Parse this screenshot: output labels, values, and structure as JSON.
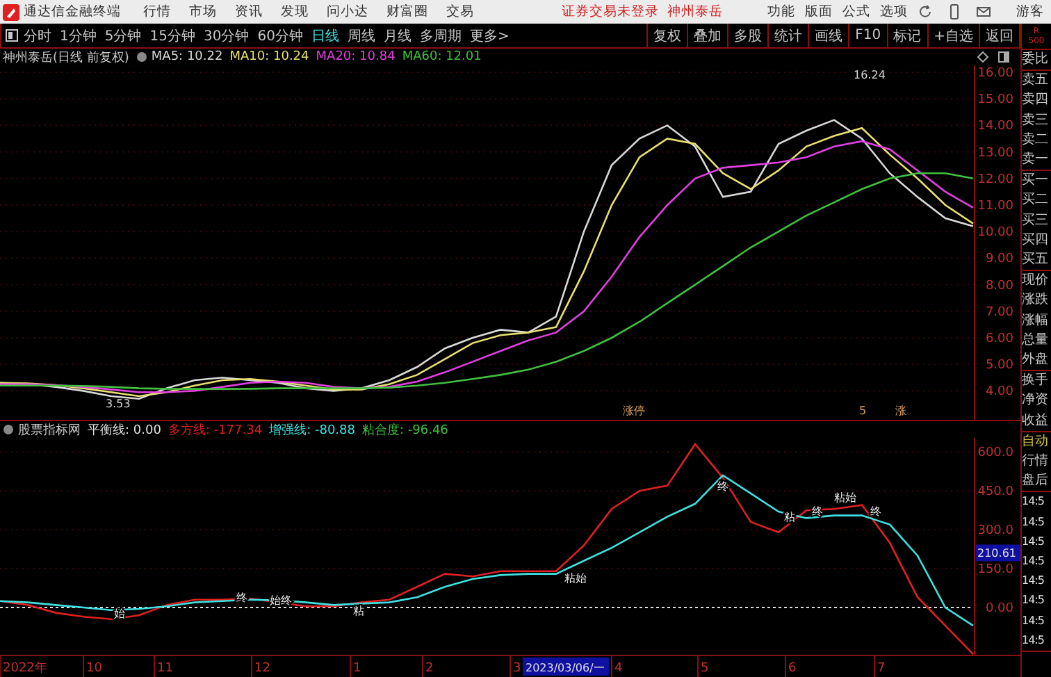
{
  "menu_bar": {
    "app_title": "通达信金融终端",
    "items": [
      "行情",
      "市场",
      "资讯",
      "发现",
      "问小达",
      "财富圈",
      "交易"
    ],
    "status": [
      "证券交易未登录",
      "神州泰岳"
    ],
    "right_items": [
      "功能",
      "版面",
      "公式",
      "选项"
    ],
    "user": "游客"
  },
  "toolbar": {
    "tabs": [
      {
        "label": "分时",
        "selected": false
      },
      {
        "label": "1分钟",
        "selected": false
      },
      {
        "label": "5分钟",
        "selected": false
      },
      {
        "label": "15分钟",
        "selected": false
      },
      {
        "label": "30分钟",
        "selected": false
      },
      {
        "label": "60分钟",
        "selected": false
      },
      {
        "label": "日线",
        "selected": true
      },
      {
        "label": "周线",
        "selected": false
      },
      {
        "label": "月线",
        "selected": false
      },
      {
        "label": "多周期",
        "selected": false
      },
      {
        "label": "更多>",
        "selected": false
      }
    ],
    "buttons": [
      "复权",
      "叠加",
      "多股",
      "统计",
      "画线",
      "F10",
      "标记",
      "+自选",
      "返回"
    ]
  },
  "upper_chart": {
    "title": "神州泰岳(日线 前复权)",
    "legend_values": [
      ": 10.22",
      ": 10.24",
      ": 10.84",
      ": 12.01"
    ],
    "markers": [
      "涨停",
      "5",
      "涨"
    ],
    "chart_data": {
      "type": "line",
      "grid": true,
      "ylim": [
        2.91,
        16.26
      ],
      "yticks": [
        {
          "value": 16,
          "label": "16.00"
        },
        {
          "value": 15,
          "label": "15.00"
        },
        {
          "value": 14,
          "label": "14.00"
        },
        {
          "value": 13,
          "label": "13.00"
        },
        {
          "value": 12,
          "label": "12.00"
        },
        {
          "value": 11,
          "label": "11.00"
        },
        {
          "value": 10,
          "label": "10.00"
        },
        {
          "value": 9,
          "label": "9.00"
        },
        {
          "value": 8,
          "label": "8.00"
        },
        {
          "value": 7,
          "label": "7.00"
        },
        {
          "value": 6,
          "label": "6.00"
        },
        {
          "value": 5,
          "label": "5.00"
        },
        {
          "value": 4,
          "label": "4.00"
        }
      ],
      "series": [
        {
          "name": "MA5",
          "color": "#d8d8d8",
          "values": [
            4.3,
            4.25,
            4.15,
            4.0,
            3.8,
            3.7,
            4.1,
            4.4,
            4.5,
            4.4,
            4.3,
            4.1,
            4.0,
            4.1,
            4.4,
            4.9,
            5.6,
            6.0,
            6.3,
            6.2,
            6.8,
            10.0,
            12.5,
            13.5,
            14.0,
            13.2,
            11.3,
            11.5,
            13.3,
            13.8,
            14.2,
            13.5,
            12.2,
            11.3,
            10.5,
            10.2
          ]
        },
        {
          "name": "MA10",
          "color": "#e8e070",
          "values": [
            4.3,
            4.28,
            4.22,
            4.1,
            3.95,
            3.8,
            3.95,
            4.2,
            4.4,
            4.45,
            4.35,
            4.2,
            4.05,
            4.05,
            4.25,
            4.6,
            5.2,
            5.8,
            6.1,
            6.2,
            6.4,
            8.5,
            11.0,
            12.8,
            13.5,
            13.3,
            12.2,
            11.6,
            12.3,
            13.2,
            13.6,
            13.9,
            12.9,
            12.0,
            11.0,
            10.3
          ]
        },
        {
          "name": "MA20",
          "color": "#e040e0",
          "values": [
            4.25,
            4.25,
            4.22,
            4.15,
            4.05,
            3.95,
            3.95,
            4.0,
            4.15,
            4.3,
            4.35,
            4.3,
            4.15,
            4.1,
            4.15,
            4.35,
            4.7,
            5.1,
            5.5,
            5.9,
            6.2,
            7.0,
            8.3,
            9.8,
            11.0,
            12.0,
            12.4,
            12.5,
            12.6,
            12.8,
            13.2,
            13.4,
            13.1,
            12.3,
            11.5,
            10.9
          ]
        },
        {
          "name": "MA60",
          "color": "#40c040",
          "values": [
            4.2,
            4.2,
            4.2,
            4.18,
            4.15,
            4.1,
            4.08,
            4.07,
            4.07,
            4.08,
            4.1,
            4.1,
            4.1,
            4.1,
            4.12,
            4.2,
            4.3,
            4.45,
            4.6,
            4.8,
            5.1,
            5.5,
            6.0,
            6.6,
            7.3,
            8.0,
            8.7,
            9.4,
            10.0,
            10.6,
            11.1,
            11.6,
            12.0,
            12.2,
            12.2,
            12.0
          ]
        }
      ],
      "annotations": [
        "16.24",
        "3.53"
      ]
    }
  },
  "lower_chart": {
    "title": "股票指标网",
    "legend_values": [
      ": 0.00",
      ": -177.34",
      ": -80.88"
    ],
    "extra_legend": [
      {
        "text": "粘合度: -96.46",
        "color": "#40c040"
      }
    ],
    "signal_labels": [
      "始",
      "终",
      "始终",
      "粘",
      "粘始",
      "终",
      "粘",
      "终",
      "粘始",
      "终"
    ],
    "cursor_value": "210.61",
    "chart_data": {
      "type": "line",
      "grid": true,
      "ylim": [
        -182,
        654
      ],
      "yticks": [
        {
          "value": 600,
          "label": "600.0"
        },
        {
          "value": 450,
          "label": "450.0"
        },
        {
          "value": 300,
          "label": "300.0"
        },
        {
          "value": 150,
          "label": "150.0"
        },
        {
          "value": 0,
          "label": "0.00"
        }
      ],
      "series": [
        {
          "name": "平衡线",
          "color": "#e0e0e0",
          "line_style": "dashed",
          "values": [
            0,
            0,
            0,
            0,
            0,
            0,
            0,
            0,
            0,
            0,
            0,
            0,
            0,
            0,
            0,
            0,
            0,
            0,
            0,
            0,
            0,
            0,
            0,
            0,
            0,
            0,
            0,
            0,
            0,
            0,
            0,
            0,
            0,
            0,
            0,
            0
          ]
        },
        {
          "name": "多方线",
          "color": "#e02020",
          "values": [
            25,
            10,
            -20,
            -35,
            -45,
            -30,
            10,
            30,
            30,
            35,
            20,
            5,
            5,
            20,
            30,
            80,
            130,
            120,
            140,
            140,
            140,
            240,
            380,
            450,
            470,
            630,
            500,
            330,
            290,
            375,
            380,
            395,
            250,
            40,
            -70,
            -180
          ]
        },
        {
          "name": "增强线",
          "color": "#40e0e0",
          "values": [
            25,
            20,
            10,
            0,
            -10,
            -5,
            5,
            20,
            25,
            30,
            28,
            20,
            10,
            15,
            20,
            40,
            80,
            110,
            125,
            130,
            130,
            180,
            230,
            290,
            350,
            400,
            510,
            440,
            370,
            345,
            355,
            355,
            320,
            200,
            0,
            -70
          ]
        }
      ]
    }
  },
  "x_axis": {
    "labels": [
      "2022年",
      "10",
      "11",
      "12",
      "1",
      "2",
      "3",
      "4",
      "5",
      "6",
      "7"
    ],
    "cursor_date": "2023/03/06/一"
  },
  "side_panel": {
    "header": [
      "R",
      "500"
    ],
    "groups": [
      [
        {
          "text": "委比",
          "kind": "label"
        }
      ],
      [
        {
          "text": "卖五",
          "kind": "label"
        },
        {
          "text": "卖四",
          "kind": "label"
        },
        {
          "text": "卖三",
          "kind": "label"
        },
        {
          "text": "卖二",
          "kind": "label"
        },
        {
          "text": "卖一",
          "kind": "label"
        }
      ],
      [
        {
          "text": "买一",
          "kind": "label"
        },
        {
          "text": "买二",
          "kind": "label"
        },
        {
          "text": "买三",
          "kind": "label"
        },
        {
          "text": "买四",
          "kind": "label"
        },
        {
          "text": "买五",
          "kind": "label"
        }
      ],
      [
        {
          "text": "现价",
          "kind": "label"
        },
        {
          "text": "涨跌",
          "kind": "label"
        },
        {
          "text": "涨幅",
          "kind": "label"
        },
        {
          "text": "总量",
          "kind": "label"
        },
        {
          "text": "外盘",
          "kind": "label"
        }
      ],
      [
        {
          "text": "换手",
          "kind": "label"
        },
        {
          "text": "净资",
          "kind": "label"
        },
        {
          "text": "收益",
          "kind": "label"
        }
      ],
      [
        {
          "text": "自动",
          "kind": "mode"
        },
        {
          "text": "行情",
          "kind": "label"
        },
        {
          "text": "盘后",
          "kind": "label"
        }
      ],
      [
        {
          "text": "14:5",
          "kind": "time"
        },
        {
          "text": "14:5",
          "kind": "time"
        },
        {
          "text": "14:5",
          "kind": "time"
        },
        {
          "text": "14:5",
          "kind": "time"
        },
        {
          "text": "14:5",
          "kind": "time"
        },
        {
          "text": "14:5",
          "kind": "time"
        },
        {
          "text": "14:5",
          "kind": "time"
        },
        {
          "text": "14:5",
          "kind": "time"
        }
      ]
    ]
  }
}
